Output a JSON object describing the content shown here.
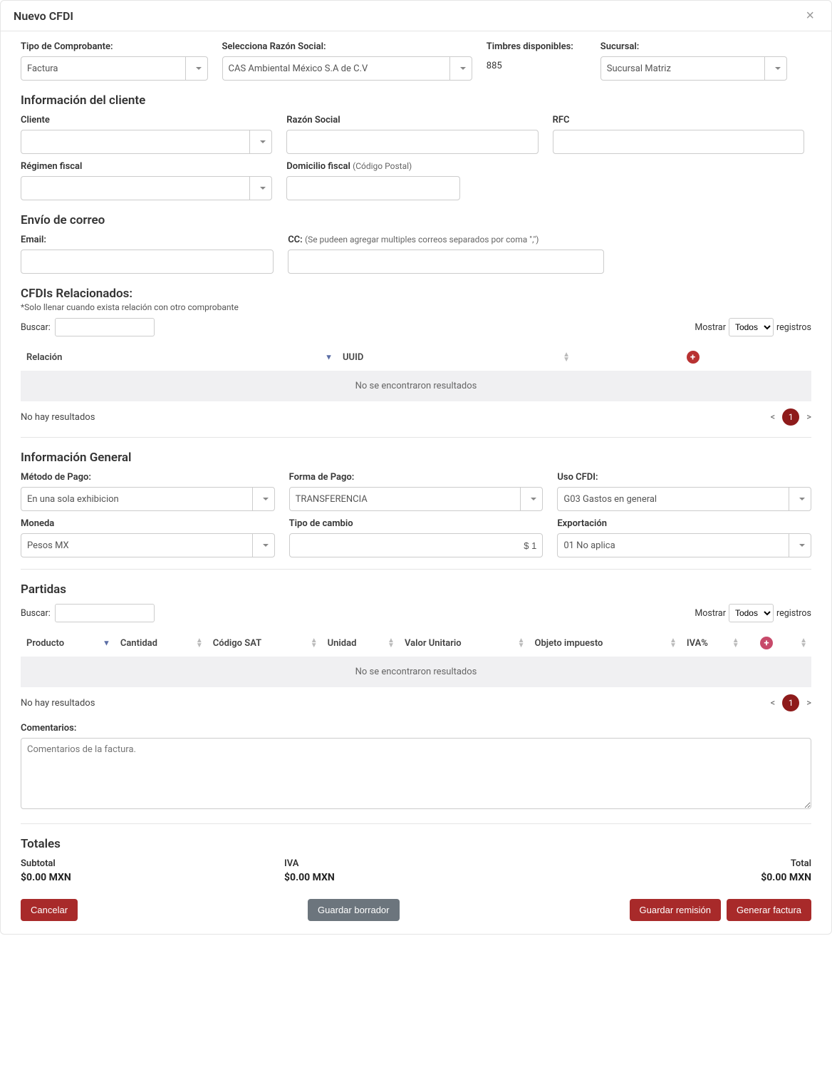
{
  "header": {
    "title": "Nuevo CFDI"
  },
  "top": {
    "tipo_label": "Tipo de Comprobante:",
    "tipo_value": "Factura",
    "razon_label": "Selecciona Razón Social:",
    "razon_value": "CAS Ambiental México S.A de C.V",
    "timbres_label": "Timbres disponibles:",
    "timbres_value": "885",
    "sucursal_label": "Sucursal:",
    "sucursal_value": "Sucursal Matriz"
  },
  "cliente": {
    "section": "Información del cliente",
    "cliente_label": "Cliente",
    "razon_label": "Razón Social",
    "rfc_label": "RFC",
    "regimen_label": "Régimen fiscal",
    "domicilio_label": "Domicilio fiscal",
    "domicilio_sub": "(Código Postal)"
  },
  "correo": {
    "section": "Envío de correo",
    "email_label": "Email:",
    "cc_label": "CC:",
    "cc_sub": "(Se pudeen agregar multiples correos separados por coma \",\")"
  },
  "relacionados": {
    "section": "CFDIs Relacionados:",
    "note": "*Solo llenar cuando exista relación con otro comprobante",
    "buscar": "Buscar:",
    "mostrar": "Mostrar",
    "mostrar_opt": "Todos",
    "registros": "registros",
    "col_relacion": "Relación",
    "col_uuid": "UUID",
    "empty": "No se encontraron resultados",
    "footer": "No hay resultados",
    "page": "1"
  },
  "general": {
    "section": "Información General",
    "metodo_label": "Método de Pago:",
    "metodo_value": "En una sola exhibicion",
    "forma_label": "Forma de Pago:",
    "forma_value": "TRANSFERENCIA",
    "uso_label": "Uso CFDI:",
    "uso_value": "G03 Gastos en general",
    "moneda_label": "Moneda",
    "moneda_value": "Pesos MX",
    "tipo_cambio_label": "Tipo de cambio",
    "tipo_cambio_value": "$ 1",
    "exportacion_label": "Exportación",
    "exportacion_value": "01 No aplica"
  },
  "partidas": {
    "section": "Partidas",
    "buscar": "Buscar:",
    "mostrar": "Mostrar",
    "mostrar_opt": "Todos",
    "registros": "registros",
    "col_producto": "Producto",
    "col_cantidad": "Cantidad",
    "col_codigo": "Código SAT",
    "col_unidad": "Unidad",
    "col_valor": "Valor Unitario",
    "col_objeto": "Objeto impuesto",
    "col_iva": "IVA%",
    "empty": "No se encontraron resultados",
    "footer": "No hay resultados",
    "page": "1"
  },
  "comentarios": {
    "label": "Comentarios:",
    "placeholder": "Comentarios de la factura."
  },
  "totales": {
    "section": "Totales",
    "subtotal_label": "Subtotal",
    "subtotal_value": "$0.00 MXN",
    "iva_label": "IVA",
    "iva_value": "$0.00 MXN",
    "total_label": "Total",
    "total_value": "$0.00 MXN"
  },
  "buttons": {
    "cancelar": "Cancelar",
    "guardar_borrador": "Guardar borrador",
    "guardar_remision": "Guardar remisión",
    "generar_factura": "Generar factura"
  }
}
